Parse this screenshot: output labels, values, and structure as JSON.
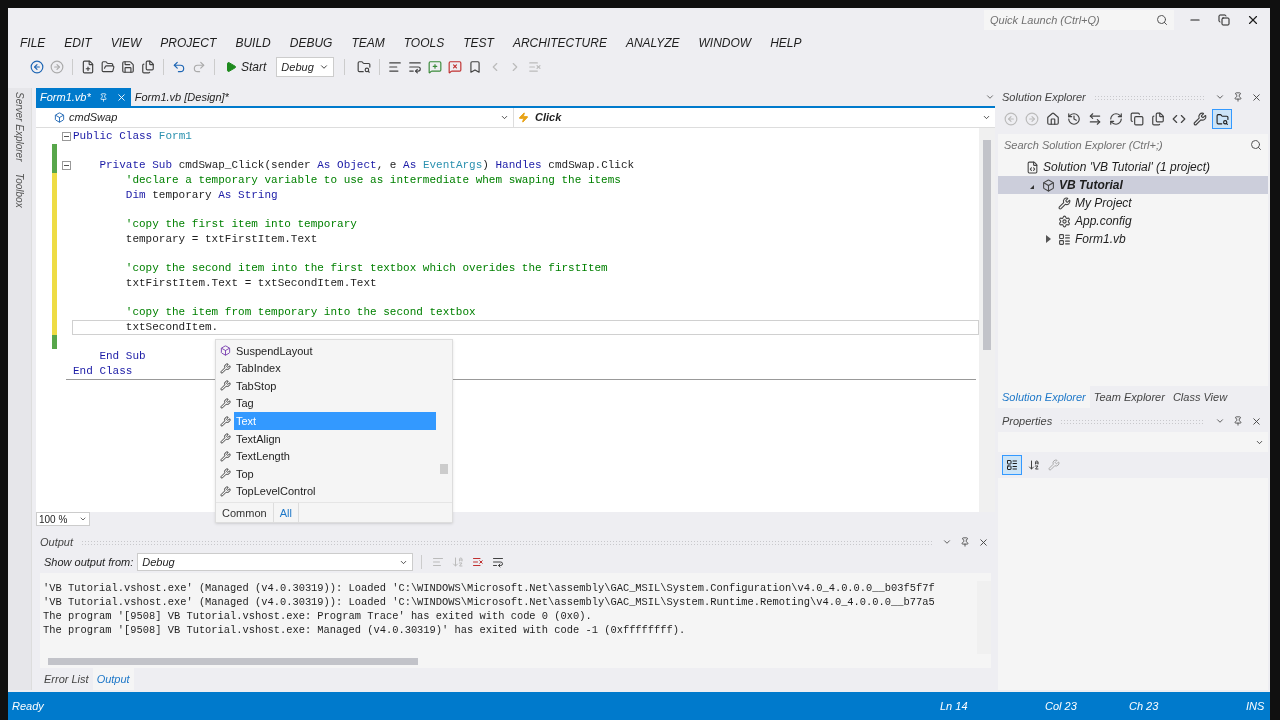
{
  "window": {
    "quick_launch": {
      "placeholder": "Quick Launch (Ctrl+Q)"
    }
  },
  "menu": [
    "FILE",
    "EDIT",
    "VIEW",
    "PROJECT",
    "BUILD",
    "DEBUG",
    "TEAM",
    "TOOLS",
    "TEST",
    "ARCHITECTURE",
    "ANALYZE",
    "WINDOW",
    "HELP"
  ],
  "toolbar": {
    "start": "Start",
    "configuration": "Debug"
  },
  "side_tabs": [
    "Server Explorer",
    "Toolbox"
  ],
  "editor": {
    "tabs": [
      {
        "label": "Form1.vb*",
        "selected": true
      },
      {
        "label": "Form1.vb [Design]*",
        "selected": false
      }
    ],
    "object": "cmdSwap",
    "event": "Click",
    "lines": [
      {
        "tokens": [
          {
            "kind": "kw",
            "text": "Public Class "
          },
          {
            "kind": "type",
            "text": "Form1"
          }
        ],
        "fold": true
      },
      {
        "saved": true
      },
      {
        "tokens": [
          {
            "kind": "kw",
            "text": "    Private Sub "
          },
          {
            "kind": "text",
            "text": "cmdSwap_Click(sender "
          },
          {
            "kind": "kw",
            "text": "As Object"
          },
          {
            "kind": "text",
            "text": ", e "
          },
          {
            "kind": "kw",
            "text": "As "
          },
          {
            "kind": "type",
            "text": "EventArgs"
          },
          {
            "kind": "text",
            "text": ") "
          },
          {
            "kind": "kw",
            "text": "Handles "
          },
          {
            "kind": "text",
            "text": "cmdSwap.Click"
          }
        ],
        "fold": true,
        "saved": true
      },
      {
        "tokens": [
          {
            "kind": "comment",
            "text": "        'declare a temporary variable to use as intermediate whem swaping the items"
          }
        ],
        "saved": false
      },
      {
        "tokens": [
          {
            "kind": "kw",
            "text": "        Dim "
          },
          {
            "kind": "text",
            "text": "temporary "
          },
          {
            "kind": "kw",
            "text": "As String"
          }
        ],
        "saved": false
      },
      {
        "saved": false
      },
      {
        "tokens": [
          {
            "kind": "comment",
            "text": "        'copy the first item into temporary"
          }
        ],
        "saved": false
      },
      {
        "tokens": [
          {
            "kind": "text",
            "text": "        temporary = txtFirstItem.Text"
          }
        ],
        "saved": false
      },
      {
        "saved": false
      },
      {
        "tokens": [
          {
            "kind": "comment",
            "text": "        'copy the second item into the first textbox which overides the firstItem"
          }
        ],
        "saved": false
      },
      {
        "tokens": [
          {
            "kind": "text",
            "text": "        txtFirstItem.Text = txtSecondItem.Text"
          }
        ],
        "saved": false
      },
      {
        "saved": false
      },
      {
        "tokens": [
          {
            "kind": "comment",
            "text": "        'copy the item from temporary into the second textbox"
          }
        ],
        "saved": false
      },
      {
        "tokens": [
          {
            "kind": "text",
            "text": "        txtSecondItem."
          }
        ],
        "saved": false,
        "current": true
      },
      {
        "saved": true
      },
      {
        "tokens": [
          {
            "kind": "kw",
            "text": "    End Sub"
          }
        ]
      },
      {
        "tokens": [
          {
            "kind": "kw",
            "text": "End Class"
          }
        ]
      }
    ],
    "zoom": "100 %"
  },
  "completion": {
    "items": [
      {
        "label": "SuspendLayout",
        "kind": "method",
        "selected": false
      },
      {
        "label": "TabIndex",
        "kind": "property",
        "selected": false
      },
      {
        "label": "TabStop",
        "kind": "property",
        "selected": false
      },
      {
        "label": "Tag",
        "kind": "property",
        "selected": false
      },
      {
        "label": "Text",
        "kind": "property",
        "selected": true
      },
      {
        "label": "TextAlign",
        "kind": "property",
        "selected": false
      },
      {
        "label": "TextLength",
        "kind": "property",
        "selected": false
      },
      {
        "label": "Top",
        "kind": "property",
        "selected": false
      },
      {
        "label": "TopLevelControl",
        "kind": "property",
        "selected": false
      }
    ],
    "filters": [
      {
        "label": "Common",
        "selected": false
      },
      {
        "label": "All",
        "selected": true
      }
    ]
  },
  "output": {
    "title": "Output",
    "source_label": "Show output from:",
    "source": "Debug",
    "lines": [
      "'VB Tutorial.vshost.exe' (Managed (v4.0.30319)): Loaded 'C:\\WINDOWS\\Microsoft.Net\\assembly\\GAC_MSIL\\System.Configuration\\v4.0_4.0.0.0__b03f5f7f",
      "'VB Tutorial.vshost.exe' (Managed (v4.0.30319)): Loaded 'C:\\WINDOWS\\Microsoft.Net\\assembly\\GAC_MSIL\\System.Runtime.Remoting\\v4.0_4.0.0.0__b77a5",
      "The program '[9508] VB Tutorial.vshost.exe: Program Trace' has exited with code 0 (0x0).",
      "The program '[9508] VB Tutorial.vshost.exe: Managed (v4.0.30319)' has exited with code -1 (0xffffffff)."
    ],
    "tabs": [
      {
        "label": "Error List",
        "selected": false
      },
      {
        "label": "Output",
        "selected": true
      }
    ]
  },
  "solution_explorer": {
    "title": "Solution Explorer",
    "search": {
      "placeholder": "Search Solution Explorer (Ctrl+;)"
    },
    "tree": [
      {
        "label": "Solution 'VB Tutorial' (1 project)",
        "kind": "solution",
        "selected": false,
        "children": [
          {
            "label": "VB Tutorial",
            "kind": "project",
            "selected": true,
            "expanded": true,
            "children": [
              {
                "label": "My Project",
                "kind": "properties",
                "selected": false
              },
              {
                "label": "App.config",
                "kind": "config",
                "selected": false
              },
              {
                "label": "Form1.vb",
                "kind": "form",
                "selected": false,
                "expanded": false
              }
            ]
          }
        ]
      }
    ],
    "tabs": [
      {
        "label": "Solution Explorer",
        "selected": true
      },
      {
        "label": "Team Explorer",
        "selected": false
      },
      {
        "label": "Class View",
        "selected": false
      }
    ]
  },
  "properties": {
    "title": "Properties"
  },
  "status_bar": {
    "message": "Ready",
    "line": "Ln 14",
    "column": "Col 23",
    "char": "Ch 23",
    "mode": "INS"
  }
}
